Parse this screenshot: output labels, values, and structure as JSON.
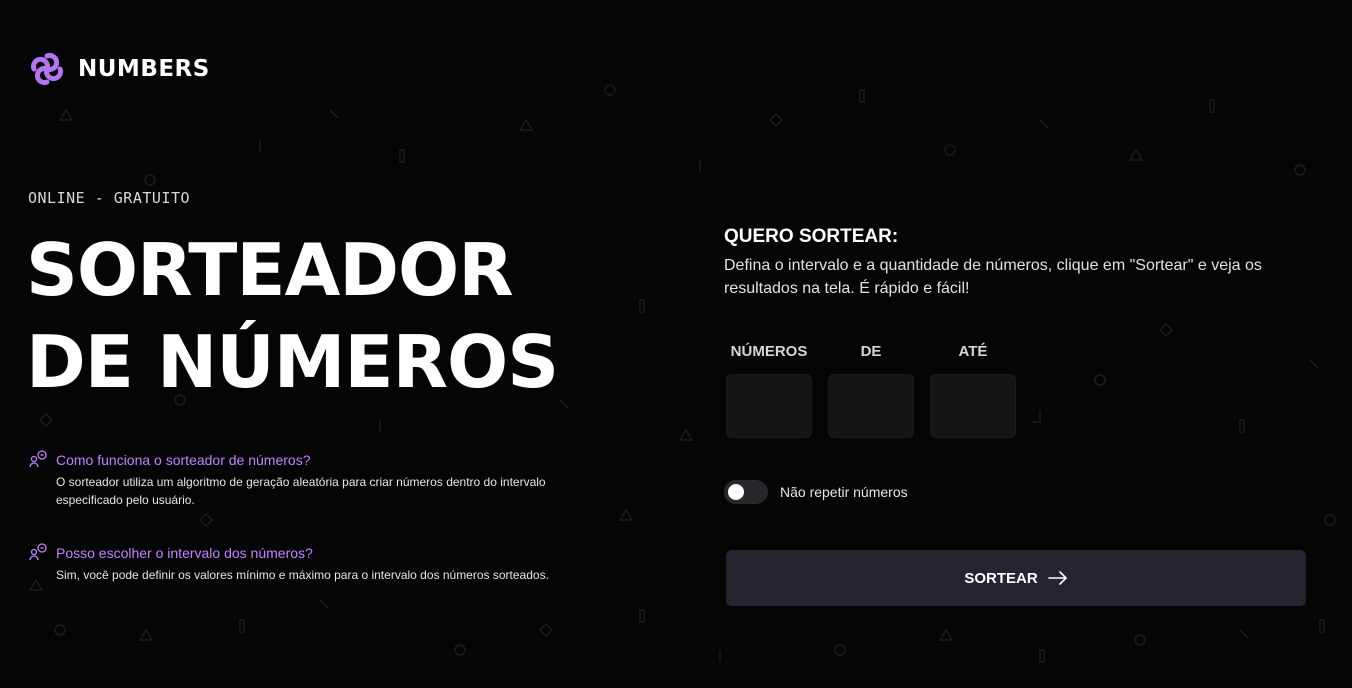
{
  "header": {
    "brand": "NUMBERS",
    "logo_icon": "knot-logo-icon",
    "logo_color": "#b277f0"
  },
  "hero": {
    "eyebrow": "ONLINE - GRATUITO",
    "title_line1": "SORTEADOR",
    "title_line2": "DE NÚMEROS"
  },
  "faq": [
    {
      "icon": "people-chat-icon",
      "question": "Como funciona o sorteador de números?",
      "answer_line1": "O sorteador utiliza um algoritmo de geração aleatória para criar números dentro do intervalo",
      "answer_line2": "especificado pelo usuário."
    },
    {
      "icon": "people-chat-icon",
      "question": "Posso escolher o intervalo dos números?",
      "answer_line1": "Sim, você pode definir os valores mínimo e máximo para o intervalo dos números sorteados."
    }
  ],
  "form": {
    "title": "QUERO SORTEAR:",
    "description_line1": "Defina o intervalo e a quantidade de números, clique em \"Sortear\" e veja os",
    "description_line2": "resultados na tela. É rápido e fácil!",
    "fields": [
      {
        "label": "NÚMEROS",
        "value": ""
      },
      {
        "label": "DE",
        "value": ""
      },
      {
        "label": "ATÉ",
        "value": ""
      }
    ],
    "toggle": {
      "label": "Não repetir números",
      "checked": false
    },
    "submit_label": "SORTEAR",
    "submit_icon": "arrow-right-icon"
  },
  "colors": {
    "background": "#050505",
    "accent": "#c084fc",
    "input_bg": "#141416",
    "button_bg": "#27232f"
  }
}
